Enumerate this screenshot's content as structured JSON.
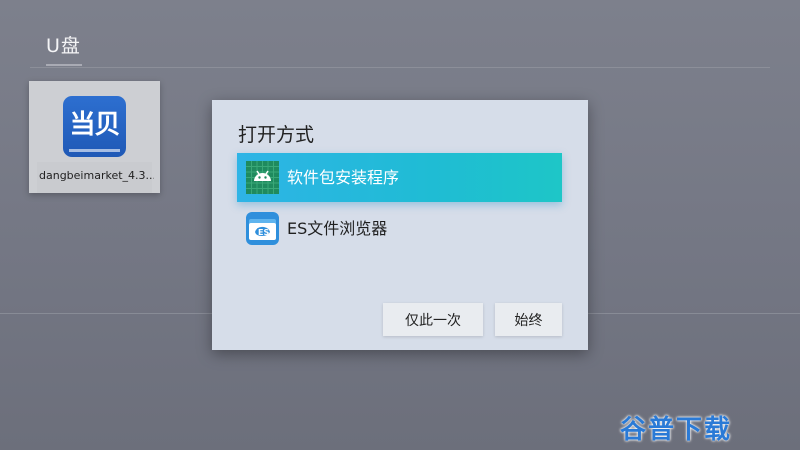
{
  "header": {
    "title": "U盘"
  },
  "file": {
    "name": "dangbeimarket_4.3...",
    "icon_text": "当贝"
  },
  "dialog": {
    "title": "打开方式",
    "options": [
      {
        "label": "软件包安装程序",
        "icon": "android-icon",
        "selected": true
      },
      {
        "label": "ES文件浏览器",
        "icon": "es-file-explorer-icon",
        "selected": false
      }
    ],
    "buttons": {
      "once": "仅此一次",
      "always": "始终"
    }
  },
  "watermark": {
    "text": "谷普下载"
  },
  "colors": {
    "background": "#747784",
    "dialog": "#d6dde9",
    "selection": "#21b8dc",
    "button": "#e9ecf0",
    "watermark": "#2a7ad6"
  }
}
